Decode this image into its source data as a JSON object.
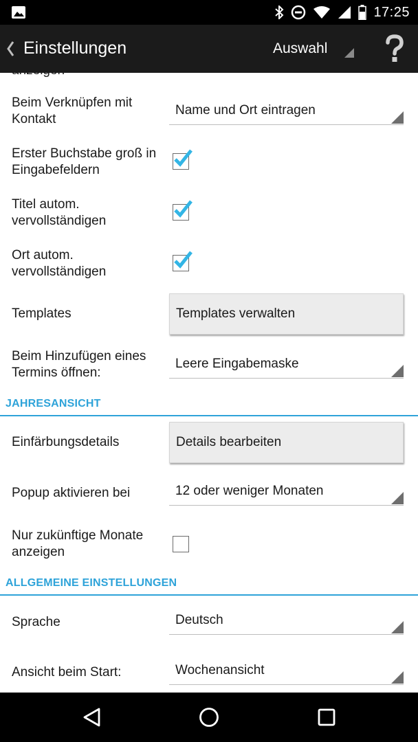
{
  "status_bar": {
    "time": "17:25",
    "icons": [
      "image-icon",
      "bluetooth-icon",
      "dnd-icon",
      "wifi-icon",
      "signal-icon",
      "battery-icon"
    ]
  },
  "action_bar": {
    "title": "Einstellungen",
    "auswahl_label": "Auswahl",
    "help_label": "?"
  },
  "clipped_text": "anzeigen",
  "settings": {
    "verknuepfen": {
      "label": "Beim Verknüpfen mit Kontakt",
      "value": "Name und Ort eintragen"
    },
    "buchstabe": {
      "label": "Erster Buchstabe groß in Eingabefeldern",
      "checked": true
    },
    "titel": {
      "label": "Titel autom. vervollständigen",
      "checked": true
    },
    "ort": {
      "label": "Ort autom. vervollständigen",
      "checked": true
    },
    "templates": {
      "label": "Templates",
      "button": "Templates verwalten"
    },
    "termin": {
      "label": "Beim Hinzufügen eines Termins öffnen:",
      "value": "Leere Eingabemaske"
    }
  },
  "section_jahr": {
    "heading": "JAHRESANSICHT"
  },
  "jahr": {
    "faerbung": {
      "label": "Einfärbungsdetails",
      "button": "Details bearbeiten"
    },
    "popup": {
      "label": "Popup aktivieren bei",
      "value": "12 oder weniger Monaten"
    },
    "zukunft": {
      "label": "Nur zukünftige Monate anzeigen",
      "checked": false
    }
  },
  "section_allg": {
    "heading": "ALLGEMEINE EINSTELLUNGEN"
  },
  "allg": {
    "sprache": {
      "label": "Sprache",
      "value": "Deutsch"
    },
    "start": {
      "label": "Ansicht beim Start:",
      "value": "Wochenansicht"
    }
  },
  "colors": {
    "accent": "#2ea3d9",
    "action_bar": "#1b1b1b",
    "checkmark": "#33b5e5"
  }
}
